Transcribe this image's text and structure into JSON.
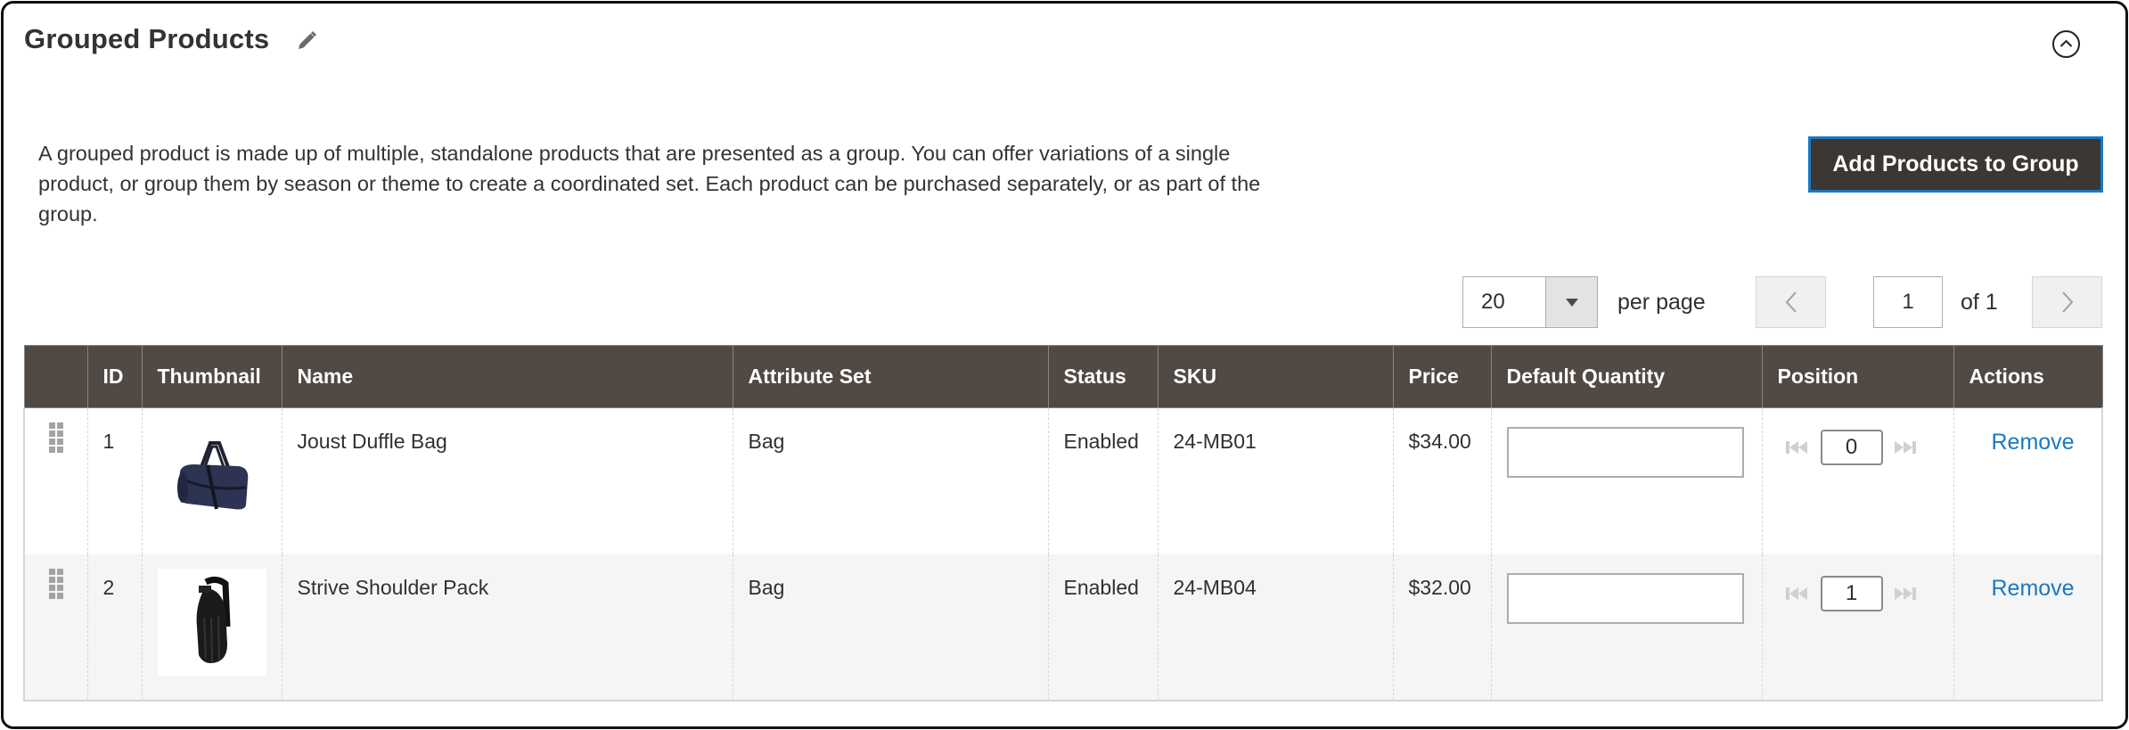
{
  "section": {
    "title": "Grouped Products",
    "description": "A grouped product is made up of multiple, standalone products that are presented as a group. You can offer variations of a single product, or group them by season or theme to create a coordinated set. Each product can be purchased separately, or as part of the group.",
    "add_button_label": "Add Products to Group"
  },
  "pagination": {
    "per_page_value": "20",
    "per_page_label": "per page",
    "prev_label": "‹",
    "next_label": "›",
    "current_page": "1",
    "total_label": "of 1"
  },
  "table": {
    "columns": [
      "",
      "ID",
      "Thumbnail",
      "Name",
      "Attribute Set",
      "Status",
      "SKU",
      "Price",
      "Default Quantity",
      "Position",
      "Actions"
    ],
    "rows": [
      {
        "id": "1",
        "thumbnail": "duffle-bag-image",
        "name": "Joust Duffle Bag",
        "attribute_set": "Bag",
        "status": "Enabled",
        "sku": "24-MB01",
        "price": "$34.00",
        "default_quantity": "",
        "position": "0",
        "action": "Remove"
      },
      {
        "id": "2",
        "thumbnail": "shoulder-pack-image",
        "name": "Strive Shoulder Pack",
        "attribute_set": "Bag",
        "status": "Enabled",
        "sku": "24-MB04",
        "price": "$32.00",
        "default_quantity": "",
        "position": "1",
        "action": "Remove"
      }
    ]
  },
  "colors": {
    "header_bg": "#514943",
    "button_bg": "#3d3733",
    "button_border": "#1979c3",
    "link": "#1979c3",
    "row_alt_bg": "#f5f5f5"
  }
}
